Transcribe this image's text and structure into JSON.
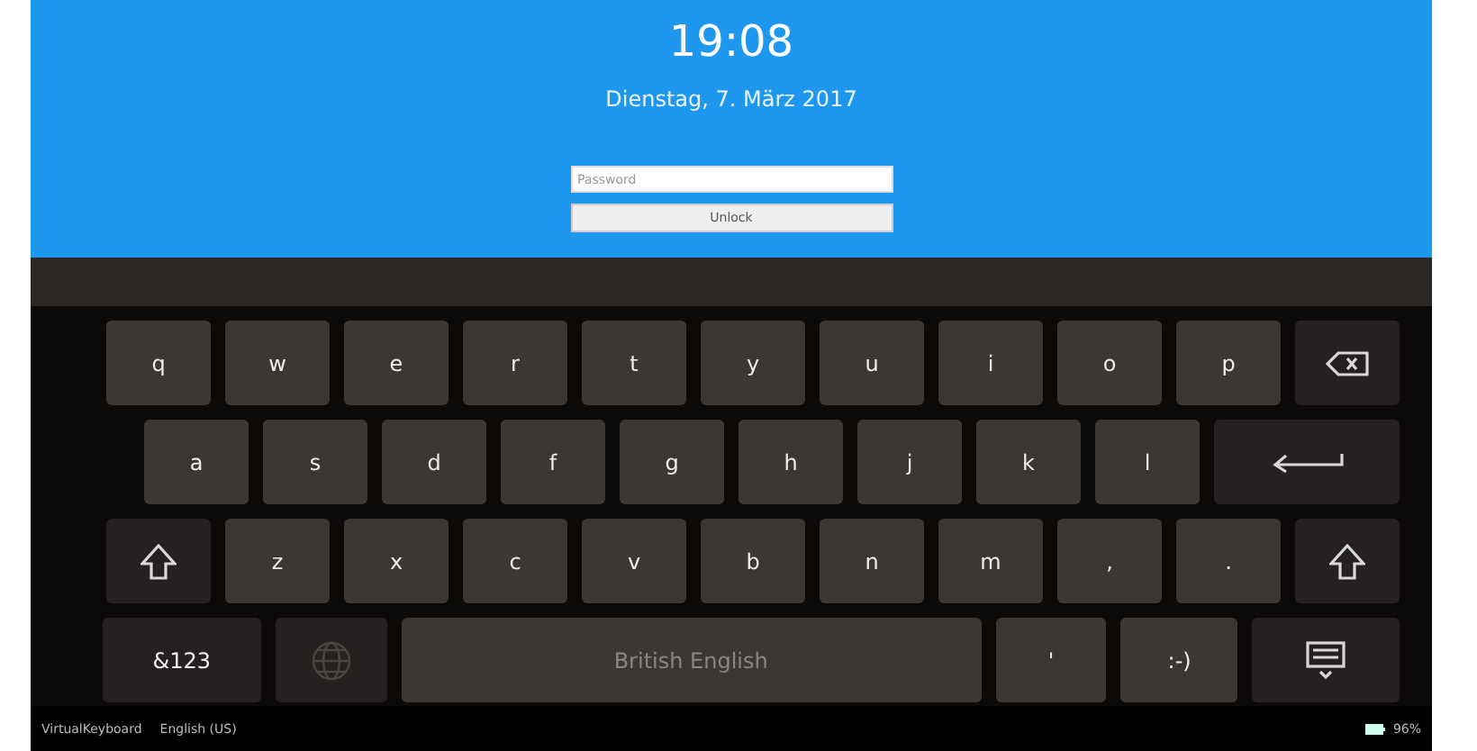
{
  "lock_screen": {
    "time": "19:08",
    "date": "Dienstag, 7. März 2017",
    "password": {
      "placeholder": "Password"
    },
    "unlock_button": "Unlock"
  },
  "keyboard": {
    "rows": [
      {
        "keys": [
          {
            "kind": "letter",
            "label": "q"
          },
          {
            "kind": "letter",
            "label": "w"
          },
          {
            "kind": "letter",
            "label": "e"
          },
          {
            "kind": "letter",
            "label": "r"
          },
          {
            "kind": "letter",
            "label": "t"
          },
          {
            "kind": "letter",
            "label": "y"
          },
          {
            "kind": "letter",
            "label": "u"
          },
          {
            "kind": "letter",
            "label": "i"
          },
          {
            "kind": "letter",
            "label": "o"
          },
          {
            "kind": "letter",
            "label": "p"
          },
          {
            "kind": "backspace"
          }
        ]
      },
      {
        "keys": [
          {
            "kind": "letter",
            "label": "a"
          },
          {
            "kind": "letter",
            "label": "s"
          },
          {
            "kind": "letter",
            "label": "d"
          },
          {
            "kind": "letter",
            "label": "f"
          },
          {
            "kind": "letter",
            "label": "g"
          },
          {
            "kind": "letter",
            "label": "h"
          },
          {
            "kind": "letter",
            "label": "j"
          },
          {
            "kind": "letter",
            "label": "k"
          },
          {
            "kind": "letter",
            "label": "l"
          },
          {
            "kind": "enter"
          }
        ]
      },
      {
        "keys": [
          {
            "kind": "shift"
          },
          {
            "kind": "letter",
            "label": "z"
          },
          {
            "kind": "letter",
            "label": "x"
          },
          {
            "kind": "letter",
            "label": "c"
          },
          {
            "kind": "letter",
            "label": "v"
          },
          {
            "kind": "letter",
            "label": "b"
          },
          {
            "kind": "letter",
            "label": "n"
          },
          {
            "kind": "letter",
            "label": "m"
          },
          {
            "kind": "letter",
            "label": ","
          },
          {
            "kind": "letter",
            "label": "."
          },
          {
            "kind": "shift"
          }
        ]
      },
      {
        "keys": [
          {
            "kind": "symbols",
            "label": "&123"
          },
          {
            "kind": "globe"
          },
          {
            "kind": "space",
            "label": "British English"
          },
          {
            "kind": "letter",
            "label": "'"
          },
          {
            "kind": "letter",
            "label": ":-)"
          },
          {
            "kind": "hide"
          }
        ]
      }
    ]
  },
  "status_bar": {
    "left": [
      "VirtualKeyboard",
      "English (US)"
    ],
    "battery": "96%"
  }
}
